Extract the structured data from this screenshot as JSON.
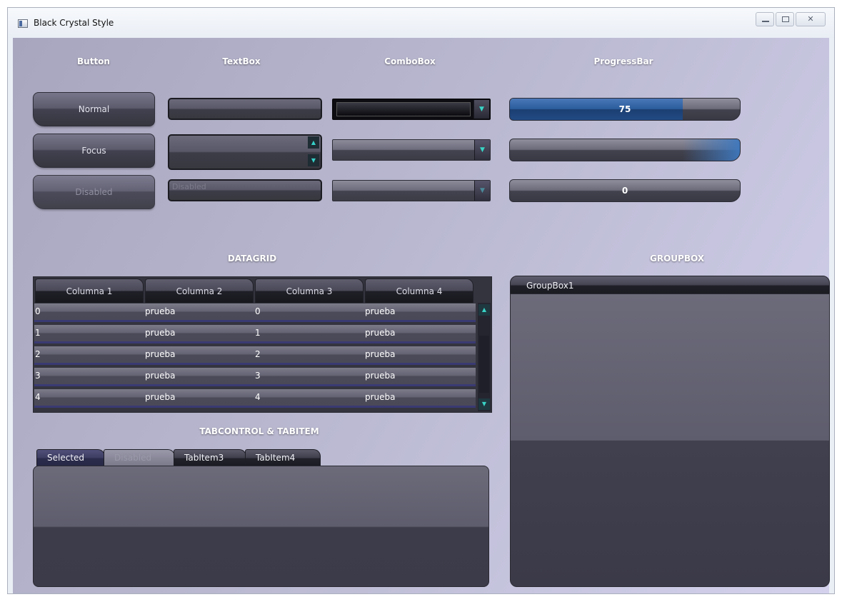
{
  "window": {
    "title": "Black Crystal Style",
    "min_glyph": "",
    "max_glyph": "",
    "close_glyph": "✕"
  },
  "headers": {
    "button": "Button",
    "textbox": "TextBox",
    "combobox": "ComboBox",
    "progressbar": "ProgressBar",
    "datagrid": "DATAGRID",
    "groupbox": "GROUPBOX",
    "tabcontrol": "TABCONTROL & TABITEM"
  },
  "buttons": {
    "normal": "Normal",
    "focus": "Focus",
    "disabled": "Disabled"
  },
  "textboxes": {
    "disabled_text": "Disabled"
  },
  "progress": [
    {
      "label": "75",
      "value": 0.75
    },
    {
      "label": "",
      "value": 0
    },
    {
      "label": "0",
      "value": 0
    }
  ],
  "datagrid": {
    "columns": [
      "Columna 1",
      "Columna 2",
      "Columna 3",
      "Columna 4"
    ],
    "rows": [
      [
        "0",
        "prueba",
        "0",
        "prueba"
      ],
      [
        "1",
        "prueba",
        "1",
        "prueba"
      ],
      [
        "2",
        "prueba",
        "2",
        "prueba"
      ],
      [
        "3",
        "prueba",
        "3",
        "prueba"
      ],
      [
        "4",
        "prueba",
        "4",
        "prueba"
      ]
    ]
  },
  "tabs": [
    "Selected",
    "Disabled",
    "TabItem3",
    "TabItem4"
  ],
  "groupbox": {
    "label": "GroupBox1"
  },
  "icons": {
    "up": "▲",
    "down": "▼"
  },
  "colors": {
    "accent": "#39d4c6",
    "progress_fill": "#2b5d9c"
  }
}
